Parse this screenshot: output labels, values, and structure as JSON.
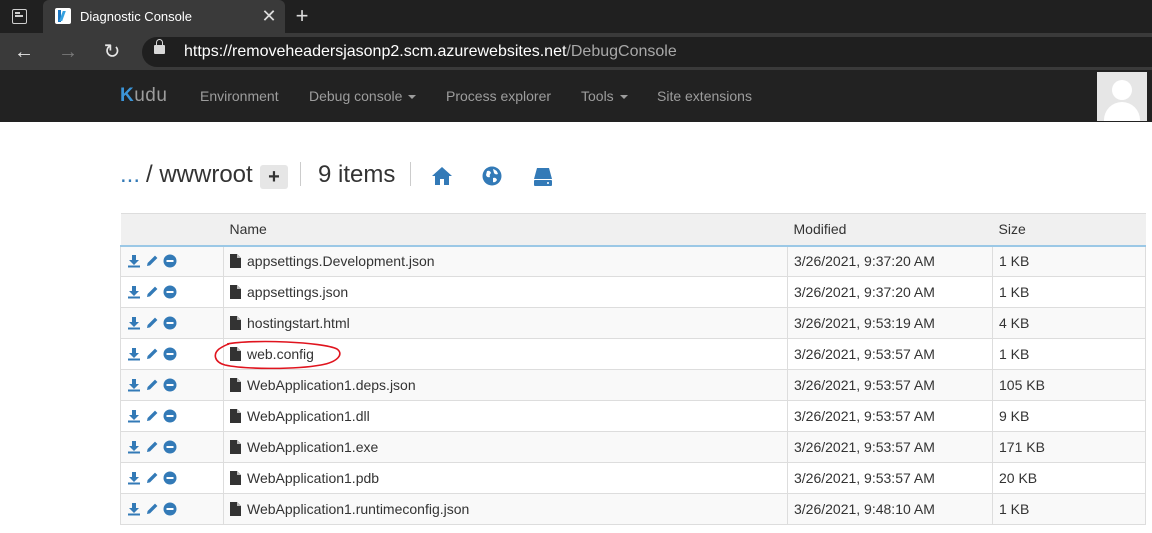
{
  "browser": {
    "tab_title": "Diagnostic Console",
    "tab_close": "✕",
    "new_tab": "+",
    "url_host": "https://removeheadersjasonp2.scm.azurewebsites.net",
    "url_path": "/DebugConsole"
  },
  "kudu_nav": {
    "brand_k": "K",
    "brand_rest": "udu",
    "items": [
      {
        "label": "Environment"
      },
      {
        "label": "Debug console",
        "dropdown": true
      },
      {
        "label": "Process explorer"
      },
      {
        "label": "Tools",
        "dropdown": true
      },
      {
        "label": "Site extensions"
      }
    ]
  },
  "breadcrumb": {
    "dots": "...",
    "current": "/ wwwroot",
    "add": "+",
    "count": "9 items"
  },
  "table": {
    "headers": [
      "Name",
      "Modified",
      "Size"
    ],
    "rows": [
      {
        "name": "appsettings.Development.json",
        "modified": "3/26/2021, 9:37:20 AM",
        "size": "1 KB"
      },
      {
        "name": "appsettings.json",
        "modified": "3/26/2021, 9:37:20 AM",
        "size": "1 KB"
      },
      {
        "name": "hostingstart.html",
        "modified": "3/26/2021, 9:53:19 AM",
        "size": "4 KB"
      },
      {
        "name": "web.config",
        "modified": "3/26/2021, 9:53:57 AM",
        "size": "1 KB"
      },
      {
        "name": "WebApplication1.deps.json",
        "modified": "3/26/2021, 9:53:57 AM",
        "size": "105 KB"
      },
      {
        "name": "WebApplication1.dll",
        "modified": "3/26/2021, 9:53:57 AM",
        "size": "9 KB"
      },
      {
        "name": "WebApplication1.exe",
        "modified": "3/26/2021, 9:53:57 AM",
        "size": "171 KB"
      },
      {
        "name": "WebApplication1.pdb",
        "modified": "3/26/2021, 9:53:57 AM",
        "size": "20 KB"
      },
      {
        "name": "WebApplication1.runtimeconfig.json",
        "modified": "3/26/2021, 9:48:10 AM",
        "size": "1 KB"
      }
    ]
  },
  "colors": {
    "accent": "#337ab7",
    "annotation": "#e0141e"
  }
}
